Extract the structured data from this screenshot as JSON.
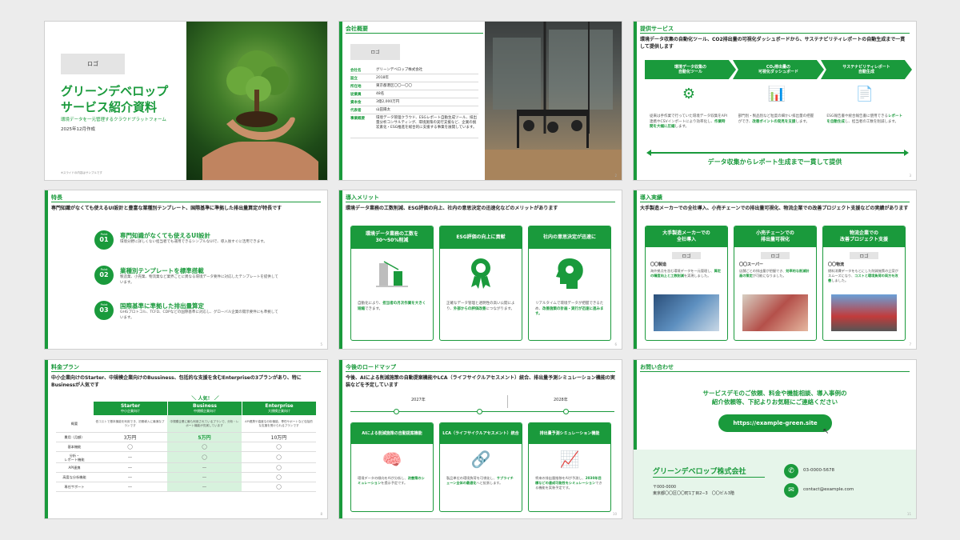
{
  "s1": {
    "logo": "ロゴ",
    "title1": "グリーンデベロップ",
    "title2": "サービス紹介資料",
    "tagline": "環境データを一元管理するクラウドプラットフォーム",
    "date": "2025年12月作成",
    "footnote": "※スライドの内容はサンプルです"
  },
  "s2": {
    "head": "会社概要",
    "logo": "ロゴ",
    "rows": [
      {
        "k": "会社名",
        "v": "グリーンデベロップ株式会社"
      },
      {
        "k": "設立",
        "v": "2018年"
      },
      {
        "k": "所在地",
        "v": "東京都港区〇〇一〇〇"
      },
      {
        "k": "従業員",
        "v": "48名"
      },
      {
        "k": "資本金",
        "v": "3億2,000万円"
      },
      {
        "k": "代表者",
        "v": "山田陽太"
      },
      {
        "k": "事業概要",
        "v": "環境データ管理クラウド、ESGレポート自動生成ツール、排出量分析コンサルティング、環境施策の実行支援など、企業の脱炭素化・ESG推進を総合的に支援する事業を展開しています。"
      }
    ],
    "page": "2"
  },
  "s3": {
    "head": "提供サービス",
    "lead": "環境データ収集の自動化ツール、CO2排出量の可視化ダッシュボードから、サステナビリティレポートの自動生成まで一貫して提供します",
    "steps": [
      "環境データ収集の\n自動化ツール",
      "CO₂排出量の\n可視化ダッシュボード",
      "サステナビリティレポート\n自動生成"
    ],
    "d1a": "従来は手作業で行っていた環境データ収集をAPI連携やCSVインポートにより効率化し、",
    "d1b": "作業時間を大幅に圧縮",
    "d1c": "します。",
    "d2a": "部門別・製品別など粒度の細かい排出量の把握ができ、",
    "d2b": "改善ポイントの発見を支援",
    "d2c": "します。",
    "d3a": "ESG報告書や統合報告書に使用できる",
    "d3b": "レポートを自動生成",
    "d3c": "し、担当者の工数を削減します。",
    "banner": "データ収集からレポート生成まで一貫して提供",
    "page": "3"
  },
  "s4": {
    "head": "特長",
    "lead": "専門知識がなくても使えるUI設計と豊富な業種別テンプレート、国際基準に準拠した排出量算定が特長です",
    "pt": "Point",
    "items": [
      {
        "n": "01",
        "t": "専門知識がなくても使えるUI設計",
        "d": "環境分野に詳しくない担当者でも運用できるシンプルなUIで、導入後すぐに活用できます。"
      },
      {
        "n": "02",
        "t": "業種別テンプレートを標準搭載",
        "d": "製造業、小売業、物流業など業界ごとに異なる環境データ要件に対応したテンプレートを提供しています。"
      },
      {
        "n": "03",
        "t": "国際基準に準拠した排出量算定",
        "d": "GHGプロトコル、TCFD、CDPなどの国際基準に対応し、グローバル企業の開示要件にも準拠しています。"
      }
    ],
    "page": "5"
  },
  "s5": {
    "head": "導入メリット",
    "lead": "環境データ業務の工数削減、ESG評価の向上、社内の意思決定の迅速化などのメリットがあります",
    "cards": [
      {
        "t": "環境データ業務の工数を\n30〜50%削減",
        "a": "自動化により、",
        "b": "担当者の月次作業を大きく短縮",
        "c": "できます。"
      },
      {
        "t": "ESG評価の向上に貢献",
        "a": "正確なデータ管理と透明性の高い公開により、",
        "b": "外部からの評価改善",
        "c": "につながります。"
      },
      {
        "t": "社内の意思決定が迅速に",
        "a": "リアルタイムで環境データが把握できるため、",
        "b": "改善施策の計画・実行が迅速に進みます。",
        "c": ""
      }
    ],
    "page": "6"
  },
  "s6": {
    "head": "導入実績",
    "lead": "大手製造メーカーでの全社導入、小売チェーンでの排出量可視化、物流企業での改善プロジェクト支援などの実績があります",
    "logo": "ロゴ",
    "cards": [
      {
        "t": "大手製造メーカーでの\n全社導入",
        "co": "〇〇製造",
        "a": "海外拠点を含む環境データを一元管理し、",
        "b": "算定の精度向上と工数削減",
        "c": "を実現しました。"
      },
      {
        "t": "小売チェーンでの\n排出量可視化",
        "co": "〇〇スーパー",
        "a": "店舗ごとの排出量が把握でき、",
        "b": "効率的な削減計画の策定",
        "c": "が可能になりました。"
      },
      {
        "t": "物流企業での\n改善プロジェクト支援",
        "co": "〇〇物流",
        "a": "燃料消費データをもとにした削減施策の立案がスムーズになり、",
        "b": "コストと環境負荷の両方を改善",
        "c": "しました。"
      }
    ],
    "page": "7"
  },
  "s7": {
    "head": "料金プラン",
    "lead": "中小企業向けのStarter、中規模企業向けのBussiness、包括的な支援を含むEnterpriseの3プランがあり、特にBusinessが人気です",
    "popular": "＼ 人気！ ／",
    "plans": [
      {
        "n": "Starter",
        "s": "中小企業向け"
      },
      {
        "n": "Business",
        "s": "中規模企業向け"
      },
      {
        "n": "Enterprise",
        "s": "大規模企業向け"
      }
    ],
    "rows": [
      {
        "k": "概要",
        "v": [
          "低コストで基本機能を利用でき、初期導入に最適なプランです",
          "中規模企業に最も利用されているプランで、分析・レポート機能が充実しています",
          "API連携や高度な分析機能、専任サポートなど包括的な支援を受けられるプランです"
        ]
      },
      {
        "k": "費用（月額）",
        "v": [
          "3万円",
          "5万円",
          "10万円"
        ]
      },
      {
        "k": "基本機能",
        "v": [
          "◯",
          "◯",
          "◯"
        ]
      },
      {
        "k": "分析・\nレポート機能",
        "v": [
          "ー",
          "◯",
          "◯"
        ]
      },
      {
        "k": "API連携",
        "v": [
          "ー",
          "ー",
          "◯"
        ]
      },
      {
        "k": "高度な分析機能",
        "v": [
          "ー",
          "ー",
          "◯"
        ]
      },
      {
        "k": "専任サポート",
        "v": [
          "ー",
          "ー",
          "◯"
        ]
      }
    ],
    "page": "8"
  },
  "s8": {
    "head": "今後のロードマップ",
    "lead": "今後、AIによる削減施策の自動提案機能やLCA（ライフサイクルアセスメント）統合、排出量予測シミュレーション機能の実装などを予定しています",
    "y1": "2027年",
    "y2": "2028年",
    "cards": [
      {
        "t": "AIによる削減施策の自動提案機能",
        "a": "環境データの傾向をAIが分析し、",
        "b": "改善策のシミュレーション",
        "c": "を提示予定です。"
      },
      {
        "t": "LCA（ライフサイクルアセスメント）統合",
        "a": "製品単位の環境負荷を可視化し、",
        "b": "サプライチェーン全体の最適化",
        "c": "へと拡張します。"
      },
      {
        "t": "排出量予測シミュレーション機能",
        "a": "将来の排出量推移をAIが予測し、",
        "b": "2030年目標などの達成可能性をシミュレーション",
        "c": "できる機能を実装予定です。"
      }
    ],
    "page": "10"
  },
  "s9": {
    "head": "お問い合わせ",
    "msg": "サービスデモのご依頼、料金や機能相談、導入事例の\n紹介依頼等、下記よりお気軽にご連絡ください",
    "url": "https://example-green.site",
    "company": "グリーンデベロップ株式会社",
    "zip": "〒000-0000",
    "addr": "東京都〇〇区〇〇町1丁目2−3　〇〇ビル3階",
    "tel": "03-0000-5678",
    "mail": "contact@example.com",
    "page": "11"
  },
  "colors": {
    "accent": "#1a9a3c",
    "light": "#e6f5ea"
  }
}
